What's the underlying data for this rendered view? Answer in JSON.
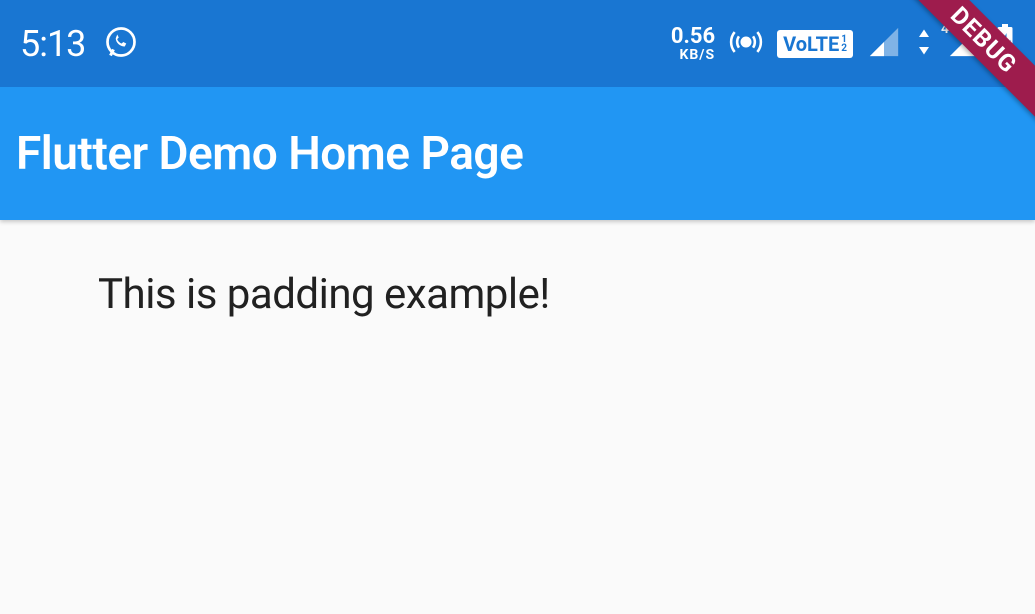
{
  "status_bar": {
    "time": "5:13",
    "speed_value": "0.56",
    "speed_unit": "KB/S",
    "volte": "VoLTE",
    "volte_1": "1",
    "volte_2": "2",
    "signal2_label": "4G+"
  },
  "app_bar": {
    "title": "Flutter Demo Home Page"
  },
  "body": {
    "text": "This is padding example!"
  },
  "debug_banner": "DEBUG"
}
